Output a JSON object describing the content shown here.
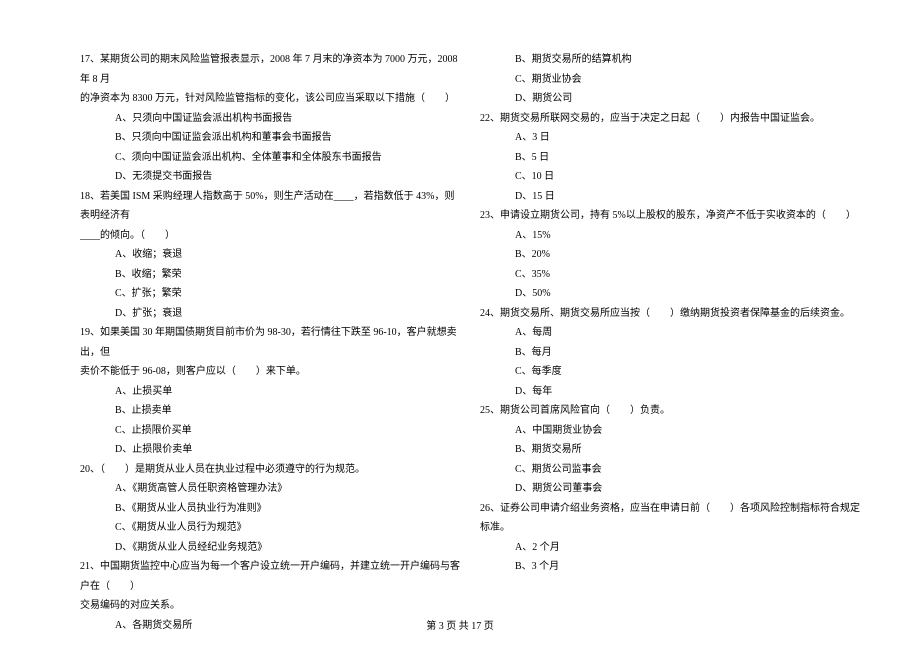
{
  "left": {
    "q17": {
      "line1": "17、某期货公司的期末风险监管报表显示，2008 年 7 月末的净资本为 7000 万元，2008 年 8 月",
      "line2": "的净资本为 8300 万元，针对风险监管指标的变化，该公司应当采取以下措施（　　）",
      "a": "A、只须向中国证监会派出机构书面报告",
      "b": "B、只须向中国证监会派出机构和董事会书面报告",
      "c": "C、须向中国证监会派出机构、全体董事和全体股东书面报告",
      "d": "D、无须提交书面报告"
    },
    "q18": {
      "line1": "18、若美国 ISM 采购经理人指数高于 50%，则生产活动在____，若指数低于 43%，则表明经济有",
      "line2": "____的倾向。（　　）",
      "a": "A、收缩；衰退",
      "b": "B、收缩；繁荣",
      "c": "C、扩张；繁荣",
      "d": "D、扩张；衰退"
    },
    "q19": {
      "line1": "19、如果美国 30 年期国债期货目前市价为 98-30，若行情往下跌至 96-10，客户就想卖出，但",
      "line2": "卖价不能低于 96-08，则客户应以（　　）来下单。",
      "a": "A、止损买单",
      "b": "B、止损卖单",
      "c": "C、止损限价买单",
      "d": "D、止损限价卖单"
    },
    "q20": {
      "text": "20、（　　）是期货从业人员在执业过程中必须遵守的行为规范。",
      "a": "A、《期货高管人员任职资格管理办法》",
      "b": "B、《期货从业人员执业行为准则》",
      "c": "C、《期货从业人员行为规范》",
      "d": "D、《期货从业人员经纪业务规范》"
    },
    "q21": {
      "line1": "21、中国期货监控中心应当为每一个客户设立统一开户编码，并建立统一开户编码与客户在（　　）",
      "line2": "交易编码的对应关系。",
      "a": "A、各期货交易所"
    }
  },
  "right": {
    "q21_continued": {
      "b": "B、期货交易所的结算机构",
      "c": "C、期货业协会",
      "d": "D、期货公司"
    },
    "q22": {
      "text": "22、期货交易所联网交易的，应当于决定之日起（　　）内报告中国证监会。",
      "a": "A、3 日",
      "b": "B、5 日",
      "c": "C、10 日",
      "d": "D、15 日"
    },
    "q23": {
      "text": "23、申请设立期货公司，持有 5%以上股权的股东，净资产不低于实收资本的（　　）",
      "a": "A、15%",
      "b": "B、20%",
      "c": "C、35%",
      "d": "D、50%"
    },
    "q24": {
      "text": "24、期货交易所、期货交易所应当按（　　）缴纳期货投资者保障基金的后续资金。",
      "a": "A、每周",
      "b": "B、每月",
      "c": "C、每季度",
      "d": "D、每年"
    },
    "q25": {
      "text": "25、期货公司首席风险官向（　　）负责。",
      "a": "A、中国期货业协会",
      "b": "B、期货交易所",
      "c": "C、期货公司监事会",
      "d": "D、期货公司董事会"
    },
    "q26": {
      "text": "26、证券公司申请介绍业务资格，应当在申请日前（　　）各项风险控制指标符合规定标准。",
      "a": "A、2 个月",
      "b": "B、3 个月"
    }
  },
  "footer": "第 3 页 共 17 页"
}
